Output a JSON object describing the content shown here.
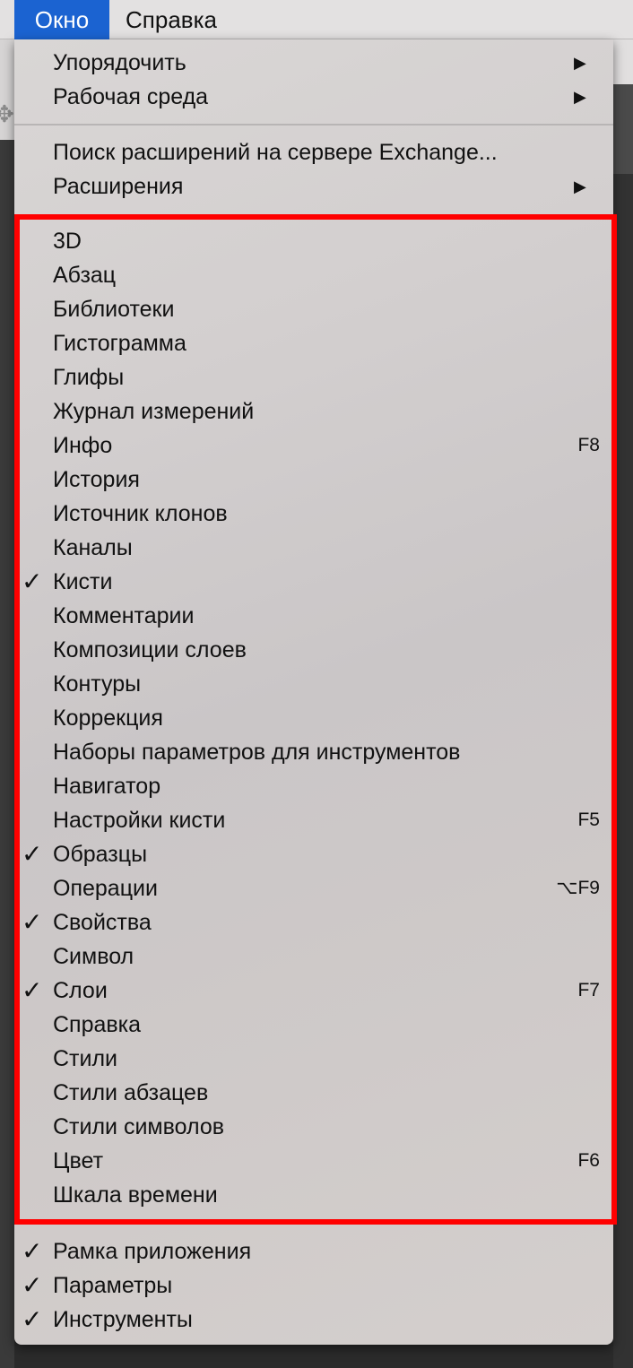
{
  "menubar": {
    "items": [
      "Окно",
      "Справка"
    ]
  },
  "menu": {
    "group1": [
      {
        "label": "Упорядочить",
        "submenu": true
      },
      {
        "label": "Рабочая среда",
        "submenu": true
      }
    ],
    "group2": [
      {
        "label": "Поиск расширений на сервере Exchange...",
        "submenu": false
      },
      {
        "label": "Расширения",
        "submenu": true
      }
    ],
    "panels": [
      {
        "label": "3D",
        "checked": false,
        "shortcut": ""
      },
      {
        "label": "Абзац",
        "checked": false,
        "shortcut": ""
      },
      {
        "label": "Библиотеки",
        "checked": false,
        "shortcut": ""
      },
      {
        "label": "Гистограмма",
        "checked": false,
        "shortcut": ""
      },
      {
        "label": "Глифы",
        "checked": false,
        "shortcut": ""
      },
      {
        "label": "Журнал измерений",
        "checked": false,
        "shortcut": ""
      },
      {
        "label": "Инфо",
        "checked": false,
        "shortcut": "F8"
      },
      {
        "label": "История",
        "checked": false,
        "shortcut": ""
      },
      {
        "label": "Источник клонов",
        "checked": false,
        "shortcut": ""
      },
      {
        "label": "Каналы",
        "checked": false,
        "shortcut": ""
      },
      {
        "label": "Кисти",
        "checked": true,
        "shortcut": ""
      },
      {
        "label": "Комментарии",
        "checked": false,
        "shortcut": ""
      },
      {
        "label": "Композиции слоев",
        "checked": false,
        "shortcut": ""
      },
      {
        "label": "Контуры",
        "checked": false,
        "shortcut": ""
      },
      {
        "label": "Коррекция",
        "checked": false,
        "shortcut": ""
      },
      {
        "label": "Наборы параметров для инструментов",
        "checked": false,
        "shortcut": ""
      },
      {
        "label": "Навигатор",
        "checked": false,
        "shortcut": ""
      },
      {
        "label": "Настройки кисти",
        "checked": false,
        "shortcut": "F5"
      },
      {
        "label": "Образцы",
        "checked": true,
        "shortcut": ""
      },
      {
        "label": "Операции",
        "checked": false,
        "shortcut": "⌥F9"
      },
      {
        "label": "Свойства",
        "checked": true,
        "shortcut": ""
      },
      {
        "label": "Символ",
        "checked": false,
        "shortcut": ""
      },
      {
        "label": "Слои",
        "checked": true,
        "shortcut": "F7"
      },
      {
        "label": "Справка",
        "checked": false,
        "shortcut": ""
      },
      {
        "label": "Стили",
        "checked": false,
        "shortcut": ""
      },
      {
        "label": "Стили абзацев",
        "checked": false,
        "shortcut": ""
      },
      {
        "label": "Стили символов",
        "checked": false,
        "shortcut": ""
      },
      {
        "label": "Цвет",
        "checked": false,
        "shortcut": "F6"
      },
      {
        "label": "Шкала времени",
        "checked": false,
        "shortcut": ""
      }
    ],
    "group4": [
      {
        "label": "Рамка приложения",
        "checked": true
      },
      {
        "label": "Параметры",
        "checked": true
      },
      {
        "label": "Инструменты",
        "checked": true
      }
    ]
  },
  "symbols": {
    "check": "✓",
    "submenu_arrow": "▶",
    "move_tool": "✥"
  },
  "colors": {
    "menubar_active": "#1b63d1",
    "highlight_box": "#ff0000"
  }
}
